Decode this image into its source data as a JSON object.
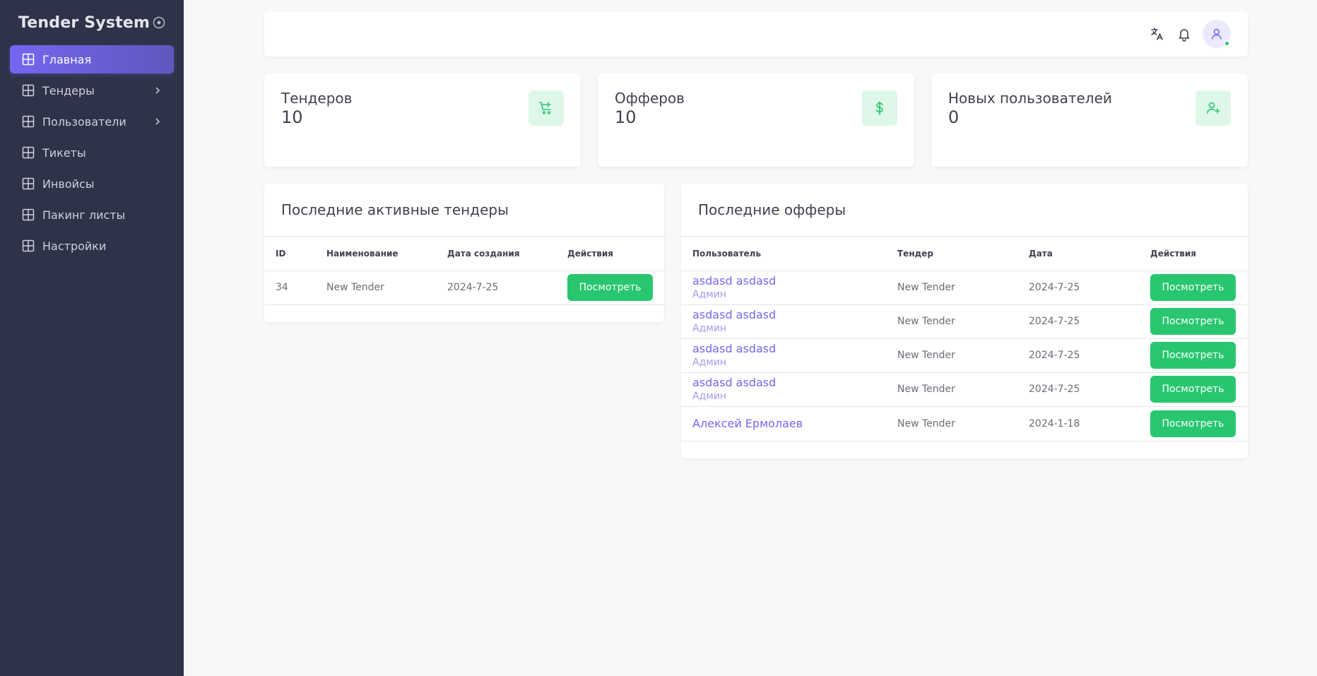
{
  "brand": {
    "title": "Tender System"
  },
  "sidebar": {
    "items": [
      {
        "label": "Главная",
        "active": true,
        "has_submenu": false
      },
      {
        "label": "Тендеры",
        "active": false,
        "has_submenu": true
      },
      {
        "label": "Пользователи",
        "active": false,
        "has_submenu": true
      },
      {
        "label": "Тикеты",
        "active": false,
        "has_submenu": false
      },
      {
        "label": "Инвойсы",
        "active": false,
        "has_submenu": false
      },
      {
        "label": "Пакинг листы",
        "active": false,
        "has_submenu": false
      },
      {
        "label": "Настройки",
        "active": false,
        "has_submenu": false
      }
    ]
  },
  "navbar": {
    "icons": [
      "translate-icon",
      "bell-icon",
      "user-icon"
    ]
  },
  "stats": [
    {
      "label": "Тендеров",
      "value": "10",
      "icon": "cart-plus-icon"
    },
    {
      "label": "Офферов",
      "value": "10",
      "icon": "dollar-icon"
    },
    {
      "label": "Новых пользователей",
      "value": "0",
      "icon": "user-plus-icon"
    }
  ],
  "tenders_card": {
    "title": "Последние активные тендеры",
    "columns": [
      "ID",
      "Наименование",
      "Дата создания",
      "Действия"
    ],
    "rows": [
      {
        "id": "34",
        "name": "New Tender",
        "date": "2024-7-25",
        "action": "Посмотреть"
      }
    ]
  },
  "offers_card": {
    "title": "Последние офферы",
    "columns": [
      "Пользователь",
      "Тендер",
      "Дата",
      "Действия"
    ],
    "rows": [
      {
        "user": "asdasd asdasd",
        "role": "Админ",
        "tender": "New Tender",
        "date": "2024-7-25",
        "action": "Посмотреть"
      },
      {
        "user": "asdasd asdasd",
        "role": "Админ",
        "tender": "New Tender",
        "date": "2024-7-25",
        "action": "Посмотреть"
      },
      {
        "user": "asdasd asdasd",
        "role": "Админ",
        "tender": "New Tender",
        "date": "2024-7-25",
        "action": "Посмотреть"
      },
      {
        "user": "asdasd asdasd",
        "role": "Админ",
        "tender": "New Tender",
        "date": "2024-7-25",
        "action": "Посмотреть"
      },
      {
        "user": "Алексей Ермолаев",
        "role": "",
        "tender": "New Tender",
        "date": "2024-1-18",
        "action": "Посмотреть"
      }
    ]
  },
  "colors": {
    "sidebar_bg": "#2f3349",
    "accent": "#7367f0",
    "success": "#28c76f",
    "page_bg": "#f8f8fa"
  }
}
